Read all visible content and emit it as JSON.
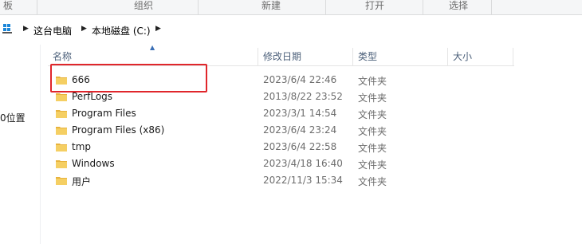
{
  "ribbon": {
    "groups": [
      "板",
      "组织",
      "新建",
      "打开",
      "选择"
    ]
  },
  "address": {
    "crumbs": [
      "这台电脑",
      "本地磁盘 (C:)"
    ]
  },
  "nav": {
    "partial_item": "0位置"
  },
  "columns": {
    "name": "名称",
    "modified": "修改日期",
    "type": "类型",
    "size": "大小"
  },
  "files": [
    {
      "name": "666",
      "modified": "2023/6/4 22:46",
      "type": "文件夹"
    },
    {
      "name": "PerfLogs",
      "modified": "2013/8/22 23:52",
      "type": "文件夹"
    },
    {
      "name": "Program Files",
      "modified": "2023/3/1 14:54",
      "type": "文件夹"
    },
    {
      "name": "Program Files (x86)",
      "modified": "2023/6/4 23:24",
      "type": "文件夹"
    },
    {
      "name": "tmp",
      "modified": "2023/6/4 22:58",
      "type": "文件夹"
    },
    {
      "name": "Windows",
      "modified": "2023/4/18 16:40",
      "type": "文件夹"
    },
    {
      "name": "用户",
      "modified": "2022/11/3 15:34",
      "type": "文件夹"
    }
  ],
  "colors": {
    "folder": "#f2c55c",
    "highlight": "#e0262b",
    "header_text": "#4c607a"
  }
}
